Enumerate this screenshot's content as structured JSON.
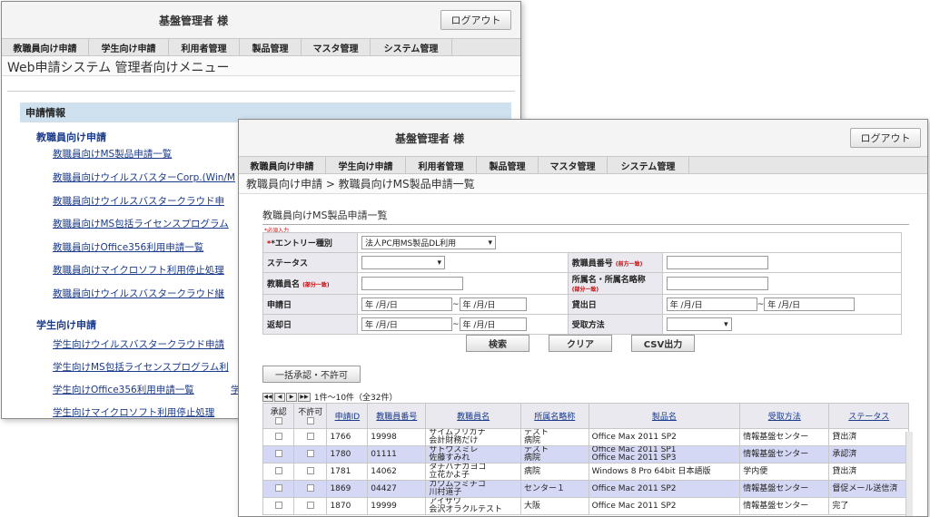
{
  "header": {
    "user": "基盤管理者 様",
    "logout": "ログアウト"
  },
  "nav": [
    "教職員向け申請",
    "学生向け申請",
    "利用者管理",
    "製品管理",
    "マスタ管理",
    "システム管理"
  ],
  "back": {
    "page_title": "Web申請システム 管理者向けメニュー",
    "section": "申請情報",
    "staff_heading": "教職員向け申請",
    "staff_links": [
      "教職員向けMS製品申請一覧",
      "教職員向けウイルスバスターCorp.(Win/M",
      "教職員向けウイルスバスタークラウド申",
      "教職員向けMS包括ライセンスプログラム",
      "教職員向けOffice356利用申請一覧",
      "教職員向けマイクロソフト利用停止処理",
      "教職員向けウイルスバスタークラウド継"
    ],
    "student_heading": "学生向け申請",
    "student_links": [
      "学生向けウイルスバスタークラウド申請",
      "学生向けMS包括ライセンスプログラム利",
      "学生向けOffice356利用申請一覧",
      "学生向けマイクロソフト利用停止処理"
    ],
    "student_extra": "学"
  },
  "front": {
    "breadcrumb": "教職員向け申請 > 教職員向けMS製品申請一覧",
    "title": "教職員向けMS製品申請一覧",
    "required_note": "*必須入力",
    "form": {
      "entry_label": "*エントリー種別",
      "entry_value": "法人PC用MS製品DL利用",
      "status_label": "ステータス",
      "staff_no_label": "教職員番号",
      "staff_no_note": "(前方一致)",
      "staff_name_label": "教職員名",
      "staff_name_note": "(部分一致)",
      "dept_label": "所属名・所属名略称",
      "dept_note": "(部分一致)",
      "apply_date_label": "申請日",
      "lend_date_label": "貸出日",
      "return_date_label": "返却日",
      "receive_label": "受取方法",
      "date_placeholder": "年 /月/日",
      "tilde": "~"
    },
    "buttons": {
      "search": "検索",
      "clear": "クリア",
      "csv": "CSV出力",
      "bulk": "一括承認・不許可"
    },
    "pager": {
      "first": "◀◀",
      "prev": "◀",
      "next": "▶",
      "last": "▶▶",
      "info": "1件～10件（全32件）"
    },
    "columns": [
      "承認",
      "不許可",
      "申請ID",
      "教職員番号",
      "教職員名",
      "所属名略称",
      "製品名",
      "受取方法",
      "ステータス"
    ],
    "rows": [
      {
        "id": "1766",
        "no": "19998",
        "name1": "ザイムフリガナ",
        "name2": "会計財務だけ",
        "dept1": "テスト",
        "dept2": "病院",
        "prod1": "Office Max 2011 SP2",
        "prod2": "",
        "recv": "情報基盤センター",
        "status": "貸出済"
      },
      {
        "id": "1780",
        "no": "01111",
        "name1": "サトウスミレ",
        "name2": "佐藤すみれ",
        "dept1": "テスト",
        "dept2": "病院",
        "prod1": "Office Mac 2011 SP1",
        "prod2": "Office Mac 2011 SP3",
        "recv": "情報基盤センター",
        "status": "承認済"
      },
      {
        "id": "1781",
        "no": "14062",
        "name1": "タチバナカヨコ",
        "name2": "立花かよ子",
        "dept1": "病院",
        "dept2": "",
        "prod1": "Windows 8 Pro 64bit 日本語版",
        "prod2": "",
        "recv": "学内便",
        "status": "貸出済"
      },
      {
        "id": "1869",
        "no": "04427",
        "name1": "カワムラミチコ",
        "name2": "川村道子",
        "dept1": "センター１",
        "dept2": "",
        "prod1": "Office Mac 2011 SP2",
        "prod2": "",
        "recv": "情報基盤センター",
        "status": "督促メール送信済"
      },
      {
        "id": "1870",
        "no": "19999",
        "name1": "アイザワ",
        "name2": "会沢オラクルテスト",
        "dept1": "大阪",
        "dept2": "",
        "prod1": "Office Mac 2011 SP2",
        "prod2": "",
        "recv": "情報基盤センター",
        "status": "完了"
      }
    ]
  }
}
